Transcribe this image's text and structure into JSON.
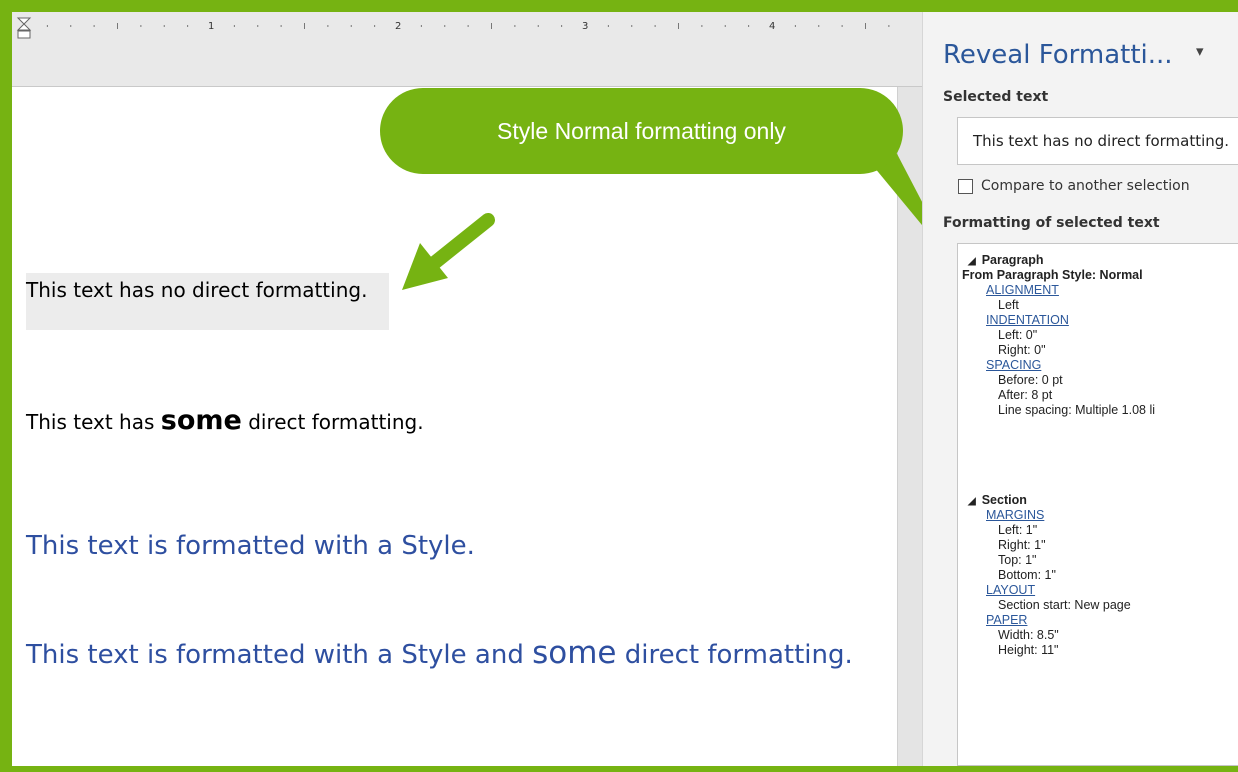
{
  "ruler": {
    "numbers": [
      "1",
      "2",
      "3",
      "4"
    ]
  },
  "document": {
    "line1": "This text has no direct formatting.",
    "line2_before": "This text has ",
    "line2_bold": "some",
    "line2_after": " direct formatting.",
    "line3": "This text is formatted with a Style.",
    "line4_before": "This text is formatted with a Style and ",
    "line4_big": "some",
    "line4_after": " direct formatting."
  },
  "callout": {
    "text": "Style Normal formatting only",
    "color": "#76b312"
  },
  "pane": {
    "title": "Reveal Formatti...",
    "caret": "▾",
    "selected_label": "Selected text",
    "selected_text": "This text has no direct formatting.",
    "compare_label": "Compare to another selection",
    "formatting_label": "Formatting of selected text",
    "paragraph": {
      "header": "Paragraph",
      "from_style": "From Paragraph Style: Normal",
      "alignment_link": "ALIGNMENT",
      "alignment_value": "Left",
      "indentation_link": "INDENTATION",
      "indent_left": "Left:  0\"",
      "indent_right": "Right:  0\"",
      "spacing_link": "SPACING",
      "spacing_before": "Before:  0 pt",
      "spacing_after": "After:  8 pt",
      "line_spacing": "Line spacing:  Multiple 1.08 li"
    },
    "section": {
      "header": "Section",
      "margins_link": "MARGINS",
      "margin_left": "Left:  1\"",
      "margin_right": "Right:  1\"",
      "margin_top": "Top:  1\"",
      "margin_bottom": "Bottom:  1\"",
      "layout_link": "LAYOUT",
      "section_start": "Section start:  New page",
      "paper_link": "PAPER",
      "paper_width": "Width:  8.5\"",
      "paper_height": "Height:  11\""
    }
  },
  "colors": {
    "frame": "#76b312",
    "style_text": "#2e4fa0",
    "link": "#2b579a"
  }
}
